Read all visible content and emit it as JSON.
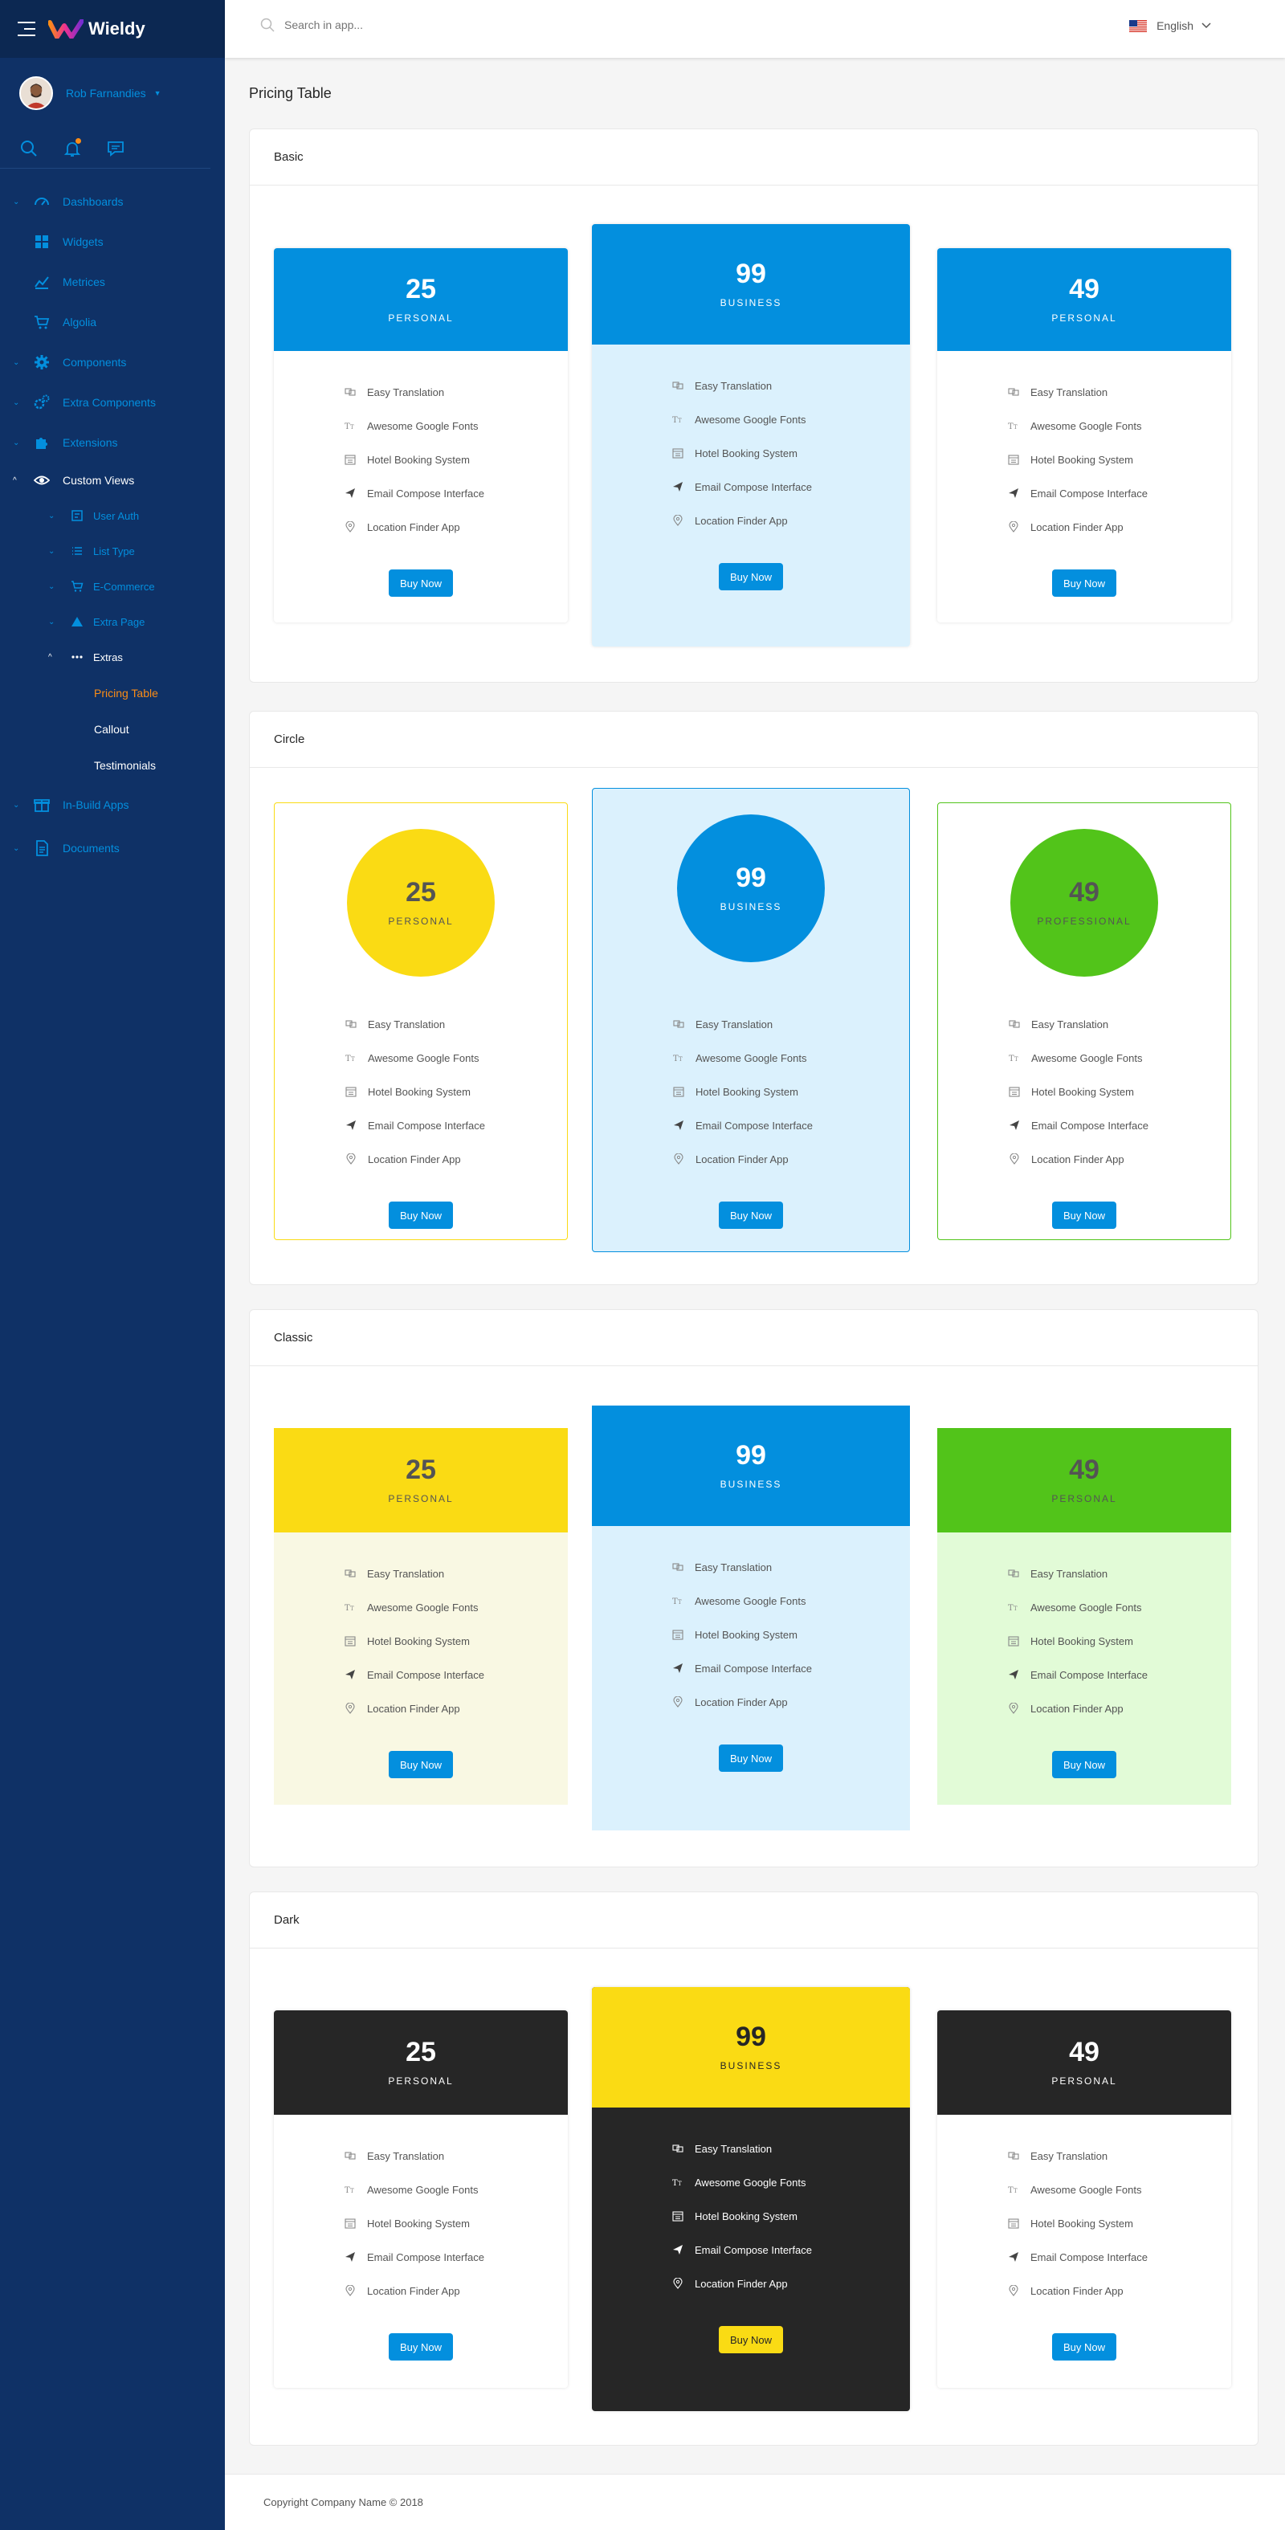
{
  "app": {
    "name": "Wieldy"
  },
  "colors": {
    "primary": "#038fde",
    "sidebar": "#0f3166",
    "accent": "#fa8c16",
    "yellow": "#fadb14",
    "green": "#52c41a",
    "dark": "#262626",
    "light_blue": "#dbf1fd",
    "light_yellow": "#f9f8e3",
    "light_green": "#e2fbd7"
  },
  "user": {
    "name": "Rob Farnandies"
  },
  "header": {
    "search_placeholder": "Search in app...",
    "language": "English"
  },
  "sidebar": {
    "items": [
      {
        "label": "Dashboards",
        "icon": "dashboard-icon"
      },
      {
        "label": "Widgets",
        "icon": "widgets-icon"
      },
      {
        "label": "Metrices",
        "icon": "chart-icon"
      },
      {
        "label": "Algolia",
        "icon": "cart-icon"
      },
      {
        "label": "Components",
        "icon": "gear-icon"
      },
      {
        "label": "Extra Components",
        "icon": "gears-icon"
      },
      {
        "label": "Extensions",
        "icon": "puzzle-icon"
      },
      {
        "label": "Custom Views",
        "icon": "eye-icon"
      }
    ],
    "sub_items": [
      {
        "label": "User Auth",
        "icon": "user-auth-icon"
      },
      {
        "label": "List Type",
        "icon": "list-icon"
      },
      {
        "label": "E-Commerce",
        "icon": "cart-icon"
      },
      {
        "label": "Extra Page",
        "icon": "triangle-icon"
      },
      {
        "label": "Extras",
        "icon": "ellipsis-icon"
      }
    ],
    "leaves": [
      {
        "label": "Pricing Table"
      },
      {
        "label": "Callout"
      },
      {
        "label": "Testimonials"
      }
    ],
    "bottom_items": [
      {
        "label": "In-Build Apps",
        "icon": "apps-icon"
      },
      {
        "label": "Documents",
        "icon": "document-icon"
      }
    ]
  },
  "page": {
    "title": "Pricing Table"
  },
  "features": [
    {
      "label": "Easy Translation",
      "icon": "translation-icon"
    },
    {
      "label": "Awesome Google Fonts",
      "icon": "font-icon"
    },
    {
      "label": "Hotel Booking System",
      "icon": "calendar-icon"
    },
    {
      "label": "Email Compose Interface",
      "icon": "send-icon"
    },
    {
      "label": "Location Finder App",
      "icon": "location-icon"
    }
  ],
  "buy_label": "Buy Now",
  "sections": [
    {
      "title": "Basic",
      "plans": [
        {
          "price": "25",
          "name": "PERSONAL"
        },
        {
          "price": "99",
          "name": "BUSINESS"
        },
        {
          "price": "49",
          "name": "PERSONAL"
        }
      ]
    },
    {
      "title": "Circle",
      "plans": [
        {
          "price": "25",
          "name": "PERSONAL"
        },
        {
          "price": "99",
          "name": "BUSINESS"
        },
        {
          "price": "49",
          "name": "PROFESSIONAL"
        }
      ]
    },
    {
      "title": "Classic",
      "plans": [
        {
          "price": "25",
          "name": "PERSONAL"
        },
        {
          "price": "99",
          "name": "BUSINESS"
        },
        {
          "price": "49",
          "name": "PERSONAL"
        }
      ]
    },
    {
      "title": "Dark",
      "plans": [
        {
          "price": "25",
          "name": "PERSONAL"
        },
        {
          "price": "99",
          "name": "BUSINESS"
        },
        {
          "price": "49",
          "name": "PERSONAL"
        }
      ]
    }
  ],
  "footer": {
    "text": "Copyright Company Name © 2018"
  }
}
